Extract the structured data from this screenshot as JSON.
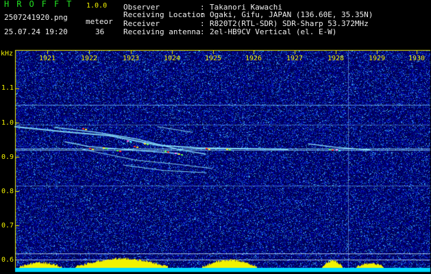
{
  "header": {
    "brand": "HROFFT",
    "version": "1.0.0",
    "filename": "2507241920.png",
    "datetime": "25.07.24 19:20",
    "meteor_label": "meteor",
    "meteor_count": "36",
    "meta": [
      {
        "label": "Observer",
        "value": "Takanori Kawachi"
      },
      {
        "label": "Receiving Location",
        "value": "Ogaki, Gifu, JAPAN (136.60E, 35.35N)"
      },
      {
        "label": "Receiver",
        "value": "R820T2(RTL-SDR) SDR-Sharp 53.372MHz"
      },
      {
        "label": "Receiving antenna",
        "value": "2el-HB9CV Vertical (el. E-W)"
      }
    ],
    "separator": ":"
  },
  "axes": {
    "unit": "kHz",
    "time_ticks": [
      "1921",
      "1922",
      "1923",
      "1924",
      "1925",
      "1926",
      "1927",
      "1928",
      "1929",
      "1930"
    ],
    "freq_ticks": [
      "1.1",
      "1.0",
      "0.9",
      "0.8",
      "0.7",
      "0.6"
    ]
  },
  "colors": {
    "brand": "#22e022",
    "text": "#f0f0f0",
    "axis": "#f2f200",
    "noise": "#0a0a8c",
    "level_bar": "#00e0ff"
  }
}
